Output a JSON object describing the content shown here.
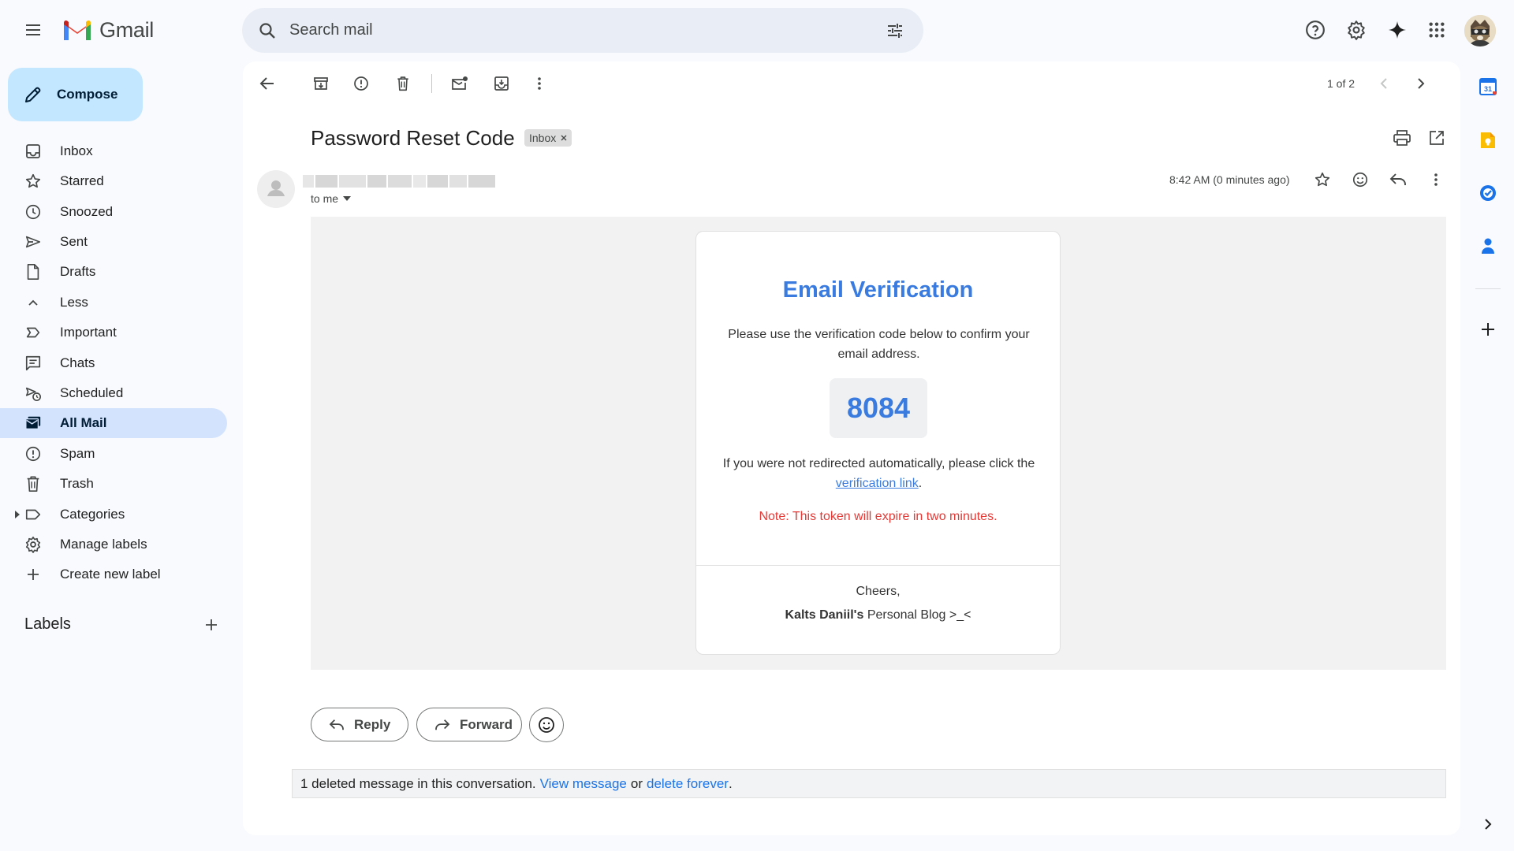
{
  "app": {
    "name": "Gmail"
  },
  "search": {
    "placeholder": "Search mail"
  },
  "sidebar": {
    "compose_label": "Compose",
    "items": [
      {
        "label": "Inbox",
        "icon": "inbox-icon"
      },
      {
        "label": "Starred",
        "icon": "star-icon"
      },
      {
        "label": "Snoozed",
        "icon": "clock-icon"
      },
      {
        "label": "Sent",
        "icon": "send-icon"
      },
      {
        "label": "Drafts",
        "icon": "draft-icon"
      },
      {
        "label": "Less",
        "icon": "chevron-up-icon"
      },
      {
        "label": "Important",
        "icon": "important-icon"
      },
      {
        "label": "Chats",
        "icon": "chat-icon"
      },
      {
        "label": "Scheduled",
        "icon": "scheduled-icon"
      },
      {
        "label": "All Mail",
        "icon": "all-mail-icon",
        "active": true
      },
      {
        "label": "Spam",
        "icon": "spam-icon"
      },
      {
        "label": "Trash",
        "icon": "trash-icon"
      },
      {
        "label": "Categories",
        "icon": "label-icon"
      },
      {
        "label": "Manage labels",
        "icon": "gear-icon"
      },
      {
        "label": "Create new label",
        "icon": "plus-icon"
      }
    ],
    "labels_title": "Labels"
  },
  "toolbar": {
    "pager": "1 of 2"
  },
  "email": {
    "subject": "Password Reset Code",
    "label_chip": "Inbox",
    "recipient": "to me",
    "timestamp": "8:42 AM (0 minutes ago)",
    "body": {
      "title": "Email Verification",
      "para1": "Please use the verification code below to confirm your email address.",
      "code": "8084",
      "para2_before": "If you were not redirected automatically, please click the ",
      "link_text": "verification link",
      "para2_after": ".",
      "note": "Note: This token will expire in two minutes.",
      "cheers": "Cheers,",
      "signature_bold": "Kalts Daniil's",
      "signature_rest": " Personal Blog >_<"
    }
  },
  "actions": {
    "reply": "Reply",
    "forward": "Forward"
  },
  "deleted_notice": {
    "text": "1 deleted message in this conversation.",
    "view_link": "View message",
    "or": "or",
    "delete_link": "delete forever",
    "end": "."
  },
  "colors": {
    "accent": "#0b57d0",
    "compose_bg": "#c2e7ff",
    "active_nav": "#d3e3fd",
    "verification_blue": "#3a7be0",
    "note_red": "#e53935"
  }
}
